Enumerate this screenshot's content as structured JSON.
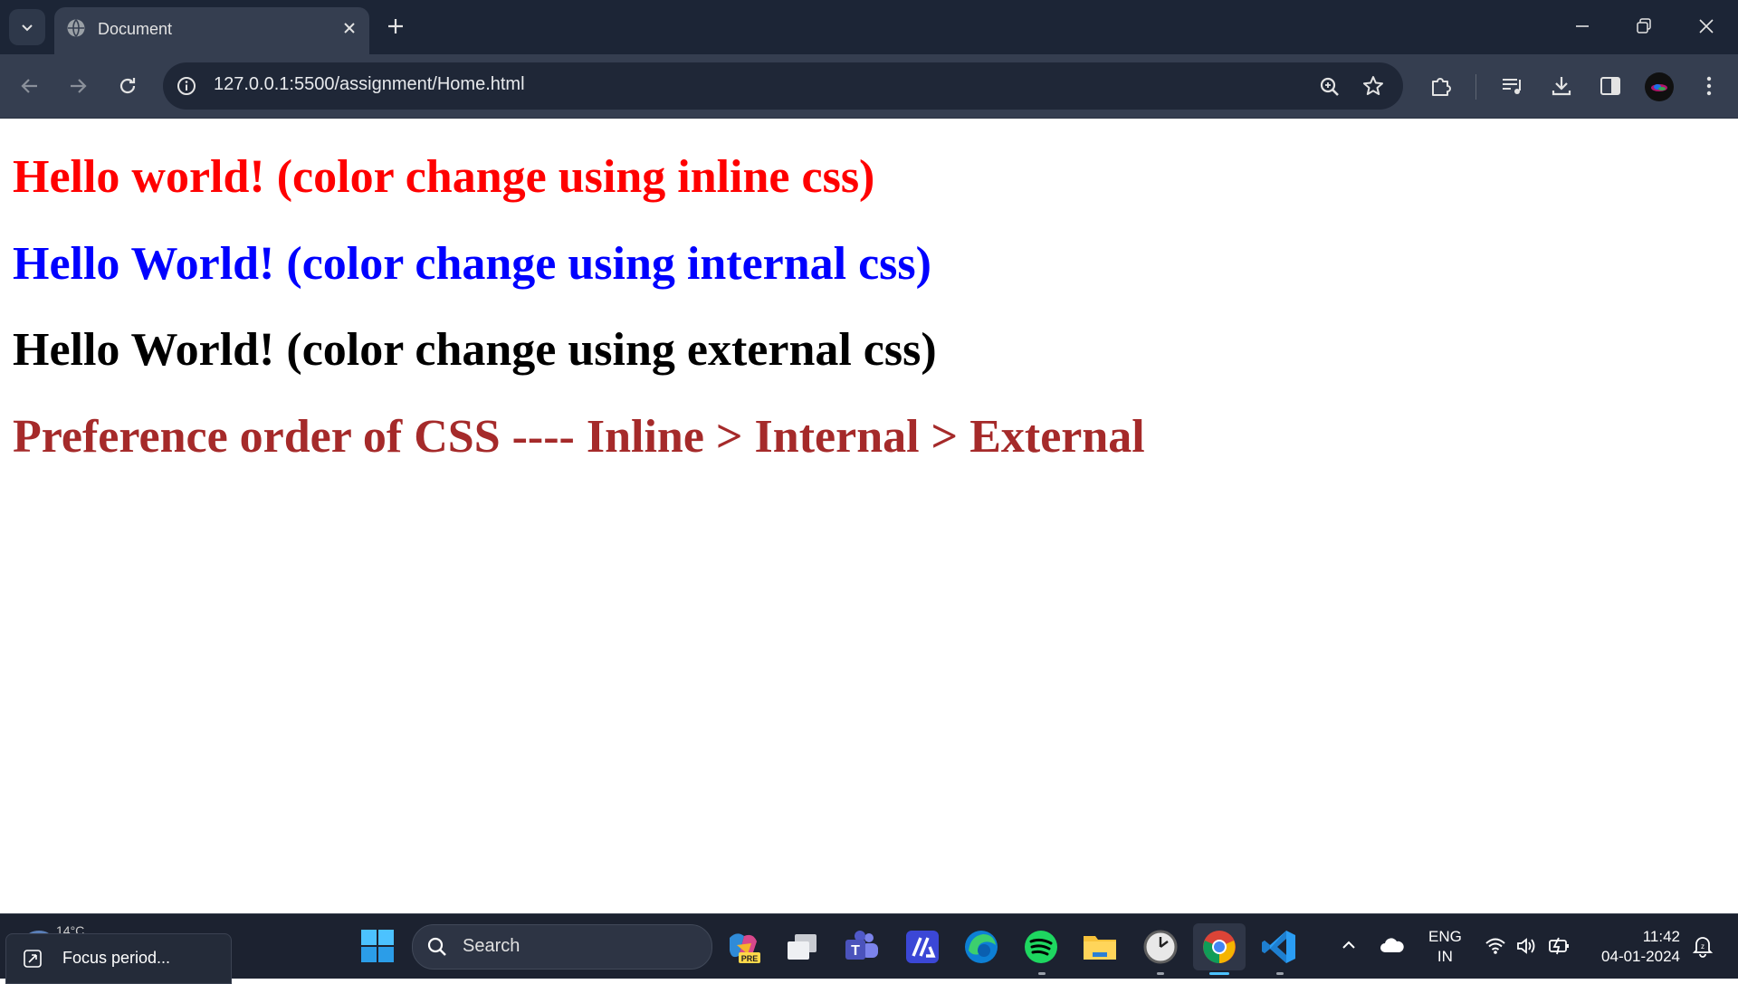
{
  "browser": {
    "tab_title": "Document",
    "url": "127.0.0.1:5500/assignment/Home.html"
  },
  "page": {
    "headings": [
      {
        "text": "Hello world! (color change using inline css)",
        "color": "#ff0000"
      },
      {
        "text": "Hello World! (color change using internal css)",
        "color": "#0000ff"
      },
      {
        "text": "Hello World! (color change using external css)",
        "color": "#000000"
      },
      {
        "text": "Preference order of CSS ---- Inline > Internal > External",
        "color": "#a52a2a"
      }
    ]
  },
  "taskbar": {
    "weather_temp": "14°C",
    "focus_label": "Focus period...",
    "search_label": "Search",
    "pinned_apps": [
      "copilot-pre",
      "task-view",
      "teams",
      "clipchamp",
      "edge",
      "spotify",
      "file-explorer",
      "clock",
      "chrome",
      "vscode"
    ],
    "lang_top": "ENG",
    "lang_bottom": "IN",
    "time": "11:42",
    "date": "04-01-2024"
  },
  "colors": {
    "chrome_dark": "#1c2536",
    "chrome_toolbar": "#353e50",
    "taskbar_bg": "#1c2230",
    "accent_blue": "#4cc2ff"
  }
}
